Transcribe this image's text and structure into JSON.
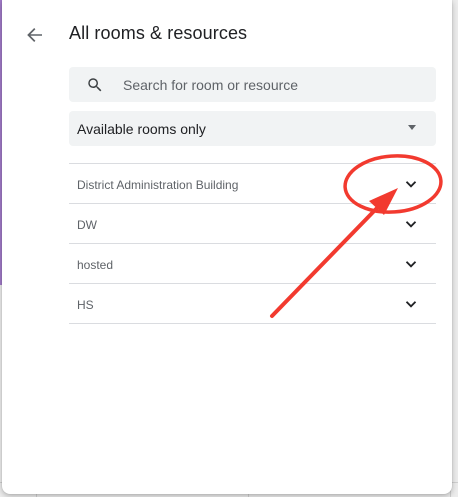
{
  "header": {
    "title": "All rooms & resources",
    "back_icon": "arrow-back-icon"
  },
  "search": {
    "placeholder": "Search for room or resource",
    "value": "",
    "icon": "search-icon"
  },
  "filter": {
    "selected": "Available rooms only",
    "icon": "dropdown-arrow-icon"
  },
  "rooms": [
    {
      "label": "District Administration Building",
      "icon": "chevron-down-icon"
    },
    {
      "label": "DW",
      "icon": "chevron-down-icon"
    },
    {
      "label": "hosted",
      "icon": "chevron-down-icon"
    },
    {
      "label": "HS",
      "icon": "chevron-down-icon"
    }
  ],
  "colors": {
    "annotation": "#f23a2f",
    "surface": "#f1f3f4",
    "text_primary": "#202124",
    "text_secondary": "#5f6368",
    "divider": "#dadce0",
    "side_accent": "#a17ac8"
  }
}
